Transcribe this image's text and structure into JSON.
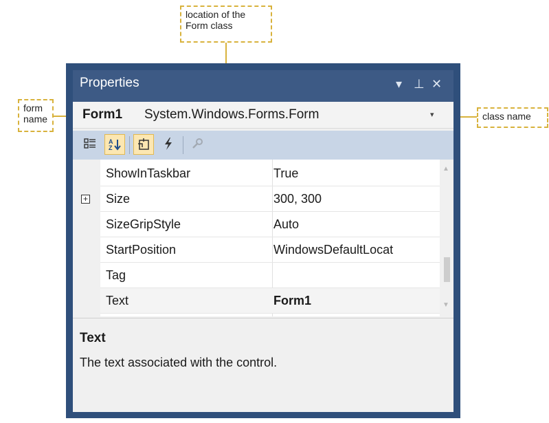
{
  "annotations": {
    "location": "location of the Form class",
    "form_name": "form name",
    "class_name": "class name"
  },
  "panel": {
    "title": "Properties",
    "controls": {
      "dropdown": "▾",
      "pin": "⊥",
      "close": "✕"
    },
    "object_name": "Form1",
    "object_class": "System.Windows.Forms.Form",
    "object_caret": "▾"
  },
  "toolbar": [
    {
      "id": "categorized",
      "icon": "categorized-icon",
      "glyph": "☷",
      "active": false
    },
    {
      "id": "alphabetical",
      "icon": "sort-az-icon",
      "glyph": "A↓",
      "active": true
    },
    {
      "id": "properties",
      "icon": "properties-icon",
      "glyph": "⎗",
      "active": true
    },
    {
      "id": "events",
      "icon": "lightning-icon",
      "glyph": "ϟ",
      "active": false
    },
    {
      "id": "property-pages",
      "icon": "wrench-icon",
      "glyph": "🔧",
      "active": false
    }
  ],
  "properties": [
    {
      "name": "ShowInTaskbar",
      "value": "True",
      "expandable": false,
      "bold": false
    },
    {
      "name": "Size",
      "value": "300, 300",
      "expandable": true,
      "bold": false
    },
    {
      "name": "SizeGripStyle",
      "value": "Auto",
      "expandable": false,
      "bold": false
    },
    {
      "name": "StartPosition",
      "value": "WindowsDefaultLocat",
      "expandable": false,
      "bold": false
    },
    {
      "name": "Tag",
      "value": "",
      "expandable": false,
      "bold": false
    },
    {
      "name": "Text",
      "value": "Form1",
      "expandable": false,
      "bold": true,
      "selected": true
    }
  ],
  "description": {
    "title": "Text",
    "body": "The text associated with the control."
  },
  "colors": {
    "callout_border": "#d8b23c",
    "title_bar": "#3d5a85",
    "toolbar": "#c8d5e6"
  }
}
